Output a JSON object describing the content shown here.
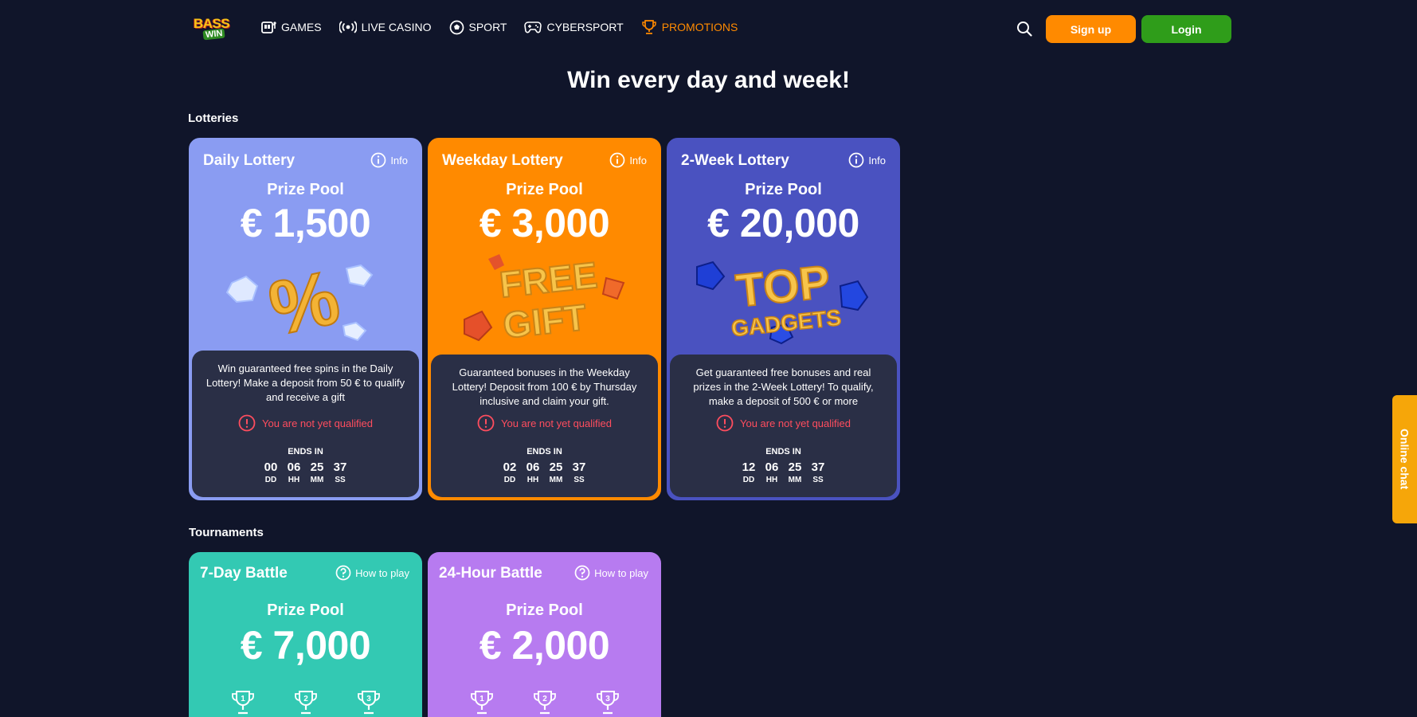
{
  "header": {
    "logo_top": "BASS",
    "logo_bottom": "WIN",
    "nav": [
      {
        "label": "GAMES",
        "icon": "slot-machine-icon"
      },
      {
        "label": "LIVE CASINO",
        "icon": "broadcast-icon"
      },
      {
        "label": "SPORT",
        "icon": "soccer-ball-icon"
      },
      {
        "label": "CYBERSPORT",
        "icon": "gamepad-icon"
      },
      {
        "label": "PROMOTIONS",
        "icon": "trophy-icon",
        "active": true
      }
    ],
    "signup_label": "Sign up",
    "login_label": "Login"
  },
  "page_title": "Win every day and week!",
  "lotteries": {
    "section_label": "Lotteries",
    "cards": [
      {
        "title": "Daily Lottery",
        "info_label": "Info",
        "prize_label": "Prize Pool",
        "prize_value": "€ 1,500",
        "art": "percent-crystals",
        "description": "Win guaranteed free spins in the Daily Lottery! Make a deposit from 50 € to qualify and receive a gift",
        "status": "You are not yet qualified",
        "ends_label": "ENDS IN",
        "timer": {
          "dd": "00",
          "hh": "06",
          "mm": "25",
          "ss": "37"
        },
        "timer_labels": {
          "dd": "DD",
          "hh": "HH",
          "mm": "MM",
          "ss": "SS"
        },
        "color": "#8a9cf2"
      },
      {
        "title": "Weekday Lottery",
        "info_label": "Info",
        "prize_label": "Prize Pool",
        "prize_value": "€ 3,000",
        "art": "free-gift",
        "art_text_1": "FREE",
        "art_text_2": "GIFT",
        "description": "Guaranteed bonuses in the Weekday Lottery! Deposit from 100 € by Thursday inclusive and claim your gift.",
        "status": "You are not yet qualified",
        "ends_label": "ENDS IN",
        "timer": {
          "dd": "02",
          "hh": "06",
          "mm": "25",
          "ss": "37"
        },
        "timer_labels": {
          "dd": "DD",
          "hh": "HH",
          "mm": "MM",
          "ss": "SS"
        },
        "color": "#ff8a00"
      },
      {
        "title": "2-Week Lottery",
        "info_label": "Info",
        "prize_label": "Prize Pool",
        "prize_value": "€ 20,000",
        "art": "top-gadgets",
        "art_text_1": "TOP",
        "art_text_2": "GADGETS",
        "description": "Get guaranteed free bonuses and real prizes in the 2-Week Lottery! To qualify, make a deposit of 500 € or more",
        "status": "You are not yet qualified",
        "ends_label": "ENDS IN",
        "timer": {
          "dd": "12",
          "hh": "06",
          "mm": "25",
          "ss": "37"
        },
        "timer_labels": {
          "dd": "DD",
          "hh": "HH",
          "mm": "MM",
          "ss": "SS"
        },
        "color": "#4a52c0"
      }
    ]
  },
  "tournaments": {
    "section_label": "Tournaments",
    "cards": [
      {
        "title": "7-Day Battle",
        "howto_label": "How to play",
        "prize_label": "Prize Pool",
        "prize_value": "€ 7,000",
        "trophies": [
          "1",
          "2",
          "3"
        ],
        "color": "#33c9b3"
      },
      {
        "title": "24-Hour Battle",
        "howto_label": "How to play",
        "prize_label": "Prize Pool",
        "prize_value": "€ 2,000",
        "trophies": [
          "1",
          "2",
          "3"
        ],
        "color": "#b77bf0"
      }
    ]
  },
  "chat_tab": "Online chat"
}
